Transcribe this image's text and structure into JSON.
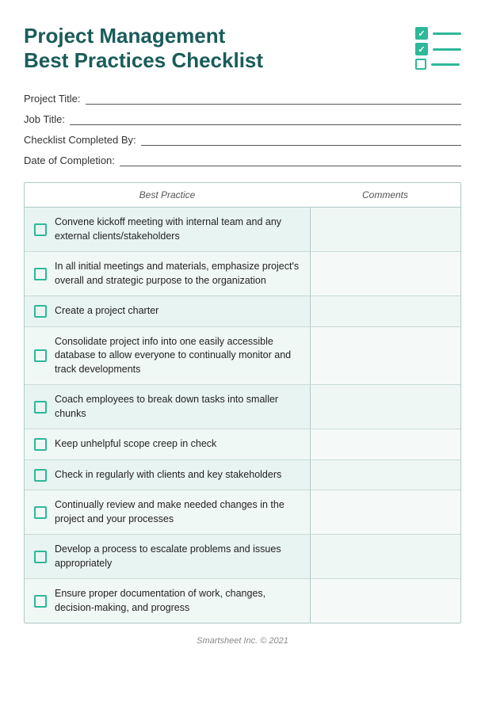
{
  "header": {
    "title_line1": "Project Management",
    "title_line2": "Best Practices Checklist"
  },
  "form": {
    "project_title_label": "Project Title:",
    "job_title_label": "Job Title:",
    "completed_by_label": "Checklist Completed By:",
    "date_label": "Date of Completion:"
  },
  "table": {
    "col_practice": "Best Practice",
    "col_comments": "Comments",
    "rows": [
      {
        "id": 1,
        "text": "Convene kickoff meeting with internal team and any external clients/stakeholders"
      },
      {
        "id": 2,
        "text": "In all initial meetings and materials, emphasize project's overall and strategic purpose to the organization"
      },
      {
        "id": 3,
        "text": "Create a project charter"
      },
      {
        "id": 4,
        "text": "Consolidate project info into one easily accessible database to allow everyone to continually monitor and track developments"
      },
      {
        "id": 5,
        "text": "Coach employees to break down tasks into smaller chunks"
      },
      {
        "id": 6,
        "text": "Keep unhelpful scope creep in check"
      },
      {
        "id": 7,
        "text": "Check in regularly with clients and key stakeholders"
      },
      {
        "id": 8,
        "text": "Continually review and make needed changes in the project and your processes"
      },
      {
        "id": 9,
        "text": "Develop a process to escalate problems and issues appropriately"
      },
      {
        "id": 10,
        "text": "Ensure proper documentation of work, changes, decision-making, and progress"
      }
    ]
  },
  "footer": {
    "text": "Smartsheet Inc. © 2021"
  }
}
